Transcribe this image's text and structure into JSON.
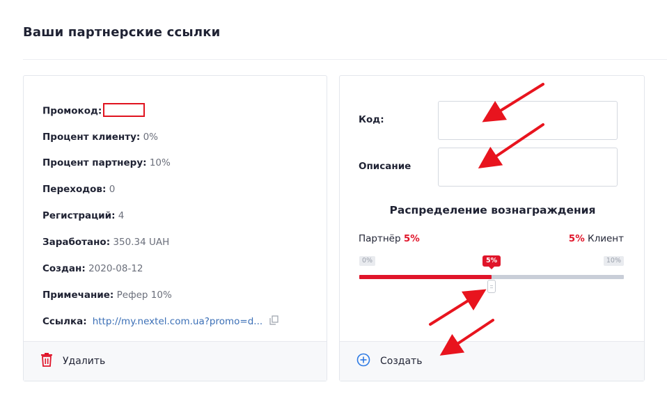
{
  "page": {
    "title": "Ваши партнерские ссылки"
  },
  "partner_link": {
    "promo_label": "Промокод:",
    "client_percent": {
      "label": "Процент клиенту:",
      "value": "0%"
    },
    "partner_percent": {
      "label": "Процент партнеру:",
      "value": "10%"
    },
    "visits": {
      "label": "Переходов:",
      "value": "0"
    },
    "registrations": {
      "label": "Регистраций:",
      "value": "4"
    },
    "earned": {
      "label": "Заработано:",
      "value": "350.34 UAH"
    },
    "created": {
      "label": "Создан:",
      "value": "2020-08-12"
    },
    "note": {
      "label": "Примечание:",
      "value": "Рефер 10%"
    },
    "link": {
      "label": "Ссылка:",
      "value": "http://my.nextel.com.ua?promo=d..."
    },
    "delete_label": "Удалить"
  },
  "create_form": {
    "code_label": "Код:",
    "code_value": "",
    "description_label": "Описание",
    "description_value": "",
    "distribution_title": "Распределение вознаграждения",
    "partner_label": "Партнёр",
    "partner_pct": "5%",
    "client_label": "Клиент",
    "client_pct": "5%",
    "slider": {
      "min_label": "0%",
      "max_label": "10%",
      "current_label": "5%",
      "value": 5,
      "min": 0,
      "max": 10
    },
    "create_label": "Создать"
  },
  "colors": {
    "accent_red": "#e0152a",
    "link_blue": "#3b6fb6",
    "create_blue": "#2d7ae4",
    "annotation_red": "#e8141e"
  },
  "icons": {
    "delete": "trash-icon",
    "create": "plus-circle-icon",
    "copy": "copy-icon"
  }
}
